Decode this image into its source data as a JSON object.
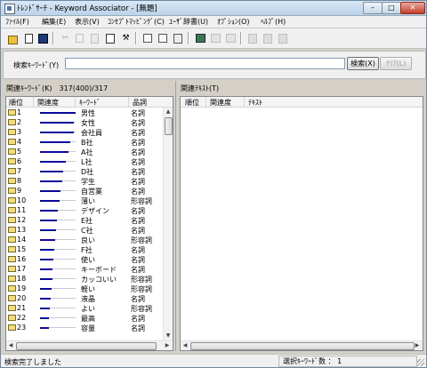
{
  "window": {
    "title": "ﾄﾚﾝﾄﾞｻｰﾁ - Keyword Associator - [無題]",
    "min": "–",
    "max": "□",
    "close": "✕"
  },
  "menu": [
    "ﾌｧｲﾙ(F)",
    "編集(E)",
    "表示(V)",
    "ｺﾝｾﾌﾟﾄﾏｯﾋﾟﾝｸﾞ(C)",
    "ﾕｰｻﾞ辞書(U)",
    "ｵﾌﾟｼｮﾝ(O)",
    "ﾍﾙﾌﾟ(H)"
  ],
  "toolbar": [
    "open-icon",
    "import-icon",
    "save-icon",
    "cut-icon",
    "copy-icon",
    "paste-icon",
    "search-doc-icon",
    "tools-icon",
    "expand-icon",
    "collapse-icon",
    "export-icon",
    "map-icon",
    "map-grid-icon",
    "map-list-icon",
    "bookmark-icon",
    "bookmark-add-icon",
    "bookmark-remove-icon"
  ],
  "search": {
    "label": "検索ｷｰﾜｰﾄﾞ(Y)",
    "value": "",
    "button": "検索(X)",
    "clear": "ｸﾘｱ(L)"
  },
  "left_pane": {
    "title": "関連ｷｰﾜｰﾄﾞ(K)　317(400)/317",
    "columns": [
      "順位",
      "関連度",
      "ｷｰﾜｰﾄﾞ",
      "品詞"
    ],
    "rows": [
      {
        "rank": "1",
        "keyword": "男性",
        "pos": "名詞",
        "relevance": 1.0
      },
      {
        "rank": "2",
        "keyword": "女性",
        "pos": "名詞",
        "relevance": 0.96
      },
      {
        "rank": "3",
        "keyword": "会社員",
        "pos": "名詞",
        "relevance": 0.96
      },
      {
        "rank": "4",
        "keyword": "B社",
        "pos": "名詞",
        "relevance": 0.86
      },
      {
        "rank": "5",
        "keyword": "A社",
        "pos": "名詞",
        "relevance": 0.8
      },
      {
        "rank": "6",
        "keyword": "L社",
        "pos": "名詞",
        "relevance": 0.72
      },
      {
        "rank": "7",
        "keyword": "D社",
        "pos": "名詞",
        "relevance": 0.66
      },
      {
        "rank": "8",
        "keyword": "学生",
        "pos": "名詞",
        "relevance": 0.62
      },
      {
        "rank": "9",
        "keyword": "自営業",
        "pos": "名詞",
        "relevance": 0.58
      },
      {
        "rank": "10",
        "keyword": "薄い",
        "pos": "形容詞",
        "relevance": 0.54
      },
      {
        "rank": "11",
        "keyword": "デザイン",
        "pos": "名詞",
        "relevance": 0.5
      },
      {
        "rank": "12",
        "keyword": "E社",
        "pos": "名詞",
        "relevance": 0.48
      },
      {
        "rank": "13",
        "keyword": "C社",
        "pos": "名詞",
        "relevance": 0.45
      },
      {
        "rank": "14",
        "keyword": "良い",
        "pos": "形容詞",
        "relevance": 0.42
      },
      {
        "rank": "15",
        "keyword": "F社",
        "pos": "名詞",
        "relevance": 0.4
      },
      {
        "rank": "16",
        "keyword": "使い",
        "pos": "名詞",
        "relevance": 0.38
      },
      {
        "rank": "17",
        "keyword": "キーボード",
        "pos": "名詞",
        "relevance": 0.36
      },
      {
        "rank": "18",
        "keyword": "カッコいい",
        "pos": "形容詞",
        "relevance": 0.34
      },
      {
        "rank": "19",
        "keyword": "軽い",
        "pos": "形容詞",
        "relevance": 0.32
      },
      {
        "rank": "20",
        "keyword": "液晶",
        "pos": "名詞",
        "relevance": 0.3
      },
      {
        "rank": "21",
        "keyword": "よい",
        "pos": "形容詞",
        "relevance": 0.28
      },
      {
        "rank": "22",
        "keyword": "最高",
        "pos": "名詞",
        "relevance": 0.26
      },
      {
        "rank": "23",
        "keyword": "容量",
        "pos": "名詞",
        "relevance": 0.24
      }
    ]
  },
  "right_pane": {
    "title": "関連ﾃｷｽﾄ(T)",
    "columns": [
      "順位",
      "関連度",
      "ﾃｷｽﾄ"
    ]
  },
  "status": {
    "left": "検索完了しました",
    "right": "選択ｷｰﾜｰﾄﾞ数 ：  1"
  },
  "colors": {
    "relevance_bar": "#0a0a9a",
    "window_bg": "#d4d0c8"
  }
}
